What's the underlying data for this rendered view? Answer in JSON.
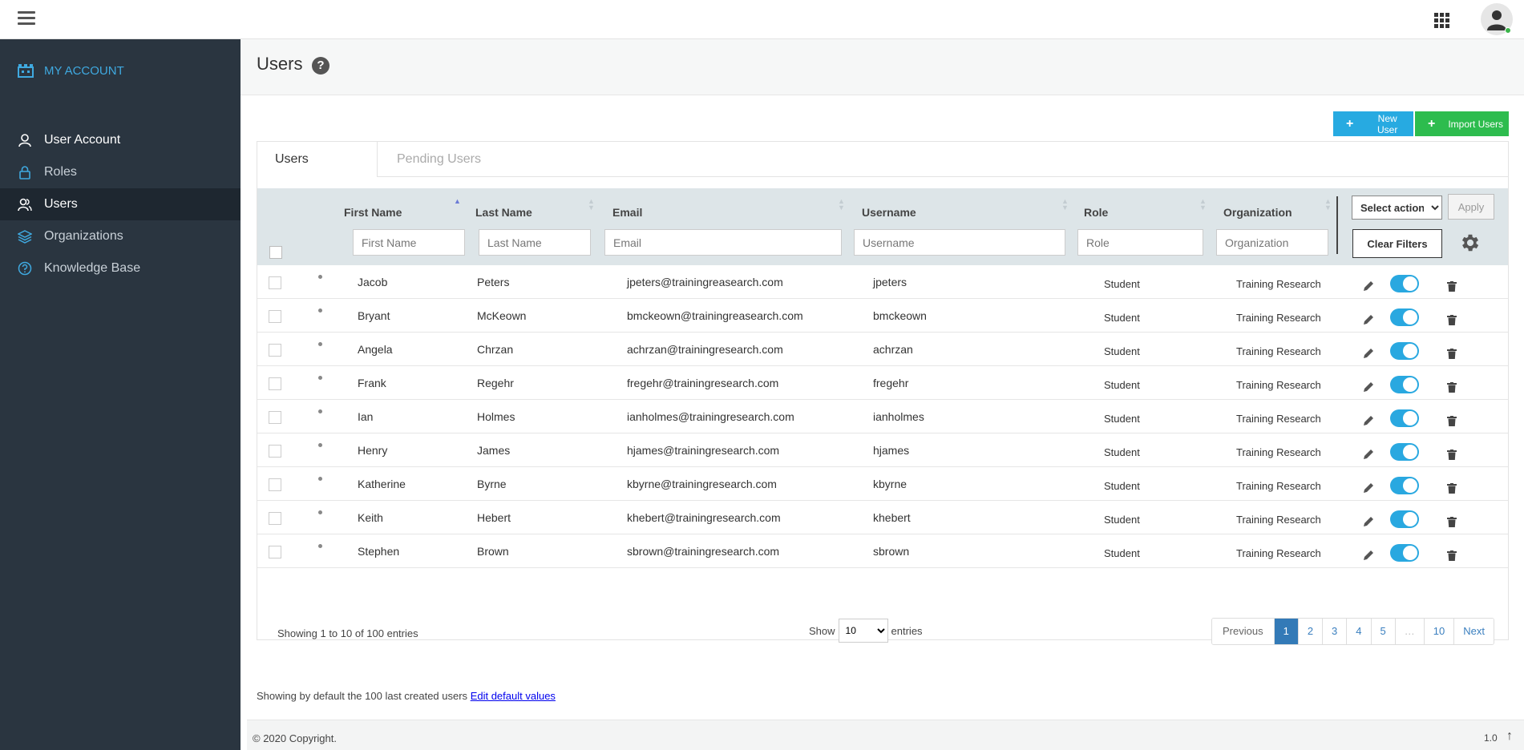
{
  "sidebar": {
    "brand": "MY ACCOUNT",
    "items": [
      {
        "label": "User Account",
        "icon": "user-outline-icon"
      },
      {
        "label": "Roles",
        "icon": "lock-icon"
      },
      {
        "label": "Users",
        "icon": "users-icon"
      },
      {
        "label": "Organizations",
        "icon": "layers-icon"
      },
      {
        "label": "Knowledge Base",
        "icon": "question-circle-icon"
      }
    ]
  },
  "page": {
    "title": "Users",
    "new_user": "New User",
    "import_users": "Import Users"
  },
  "tabs": [
    "Users",
    "Pending Users"
  ],
  "table": {
    "columns": [
      "First Name",
      "Last Name",
      "Email",
      "Username",
      "Role",
      "Organization"
    ],
    "filters": [
      "First Name",
      "Last Name",
      "Email",
      "Username",
      "Role",
      "Organization"
    ],
    "select_action": "Select action",
    "apply": "Apply",
    "clear_filters": "Clear Filters",
    "rows": [
      [
        "Jacob",
        "Peters",
        "jpeters@trainingreasearch.com",
        "jpeters",
        "Student",
        "Training Research"
      ],
      [
        "Bryant",
        "McKeown",
        "bmckeown@trainingreasearch.com",
        "bmckeown",
        "Student",
        "Training Research"
      ],
      [
        "Angela",
        "Chrzan",
        "achrzan@trainingresearch.com",
        "achrzan",
        "Student",
        "Training Research"
      ],
      [
        "Frank",
        "Regehr",
        "fregehr@trainingresearch.com",
        "fregehr",
        "Student",
        "Training Research"
      ],
      [
        "Ian",
        "Holmes",
        "ianholmes@trainingresearch.com",
        "ianholmes",
        "Student",
        "Training Research"
      ],
      [
        "Henry",
        "James",
        "hjames@trainingresearch.com",
        "hjames",
        "Student",
        "Training Research"
      ],
      [
        "Katherine",
        "Byrne",
        "kbyrne@trainingresearch.com",
        "kbyrne",
        "Student",
        "Training Research"
      ],
      [
        "Keith",
        "Hebert",
        "khebert@trainingresearch.com",
        "khebert",
        "Student",
        "Training Research"
      ],
      [
        "Stephen",
        "Brown",
        "sbrown@trainingresearch.com",
        "sbrown",
        "Student",
        "Training Research"
      ]
    ]
  },
  "footer_table": {
    "showing": "Showing 1 to 10 of 100 entries",
    "show": "Show",
    "page_size": "10",
    "entries": "entries",
    "pages": [
      "Previous",
      "1",
      "2",
      "3",
      "4",
      "5",
      "…",
      "10",
      "Next"
    ]
  },
  "note": {
    "text": "Showing by default the 100 last created users",
    "link": "Edit default values"
  },
  "footer": {
    "copyright": "© 2020 Copyright.",
    "version": "1.0",
    "arrow": "↑"
  },
  "colors": {
    "sidebar_bg": "#2a3540",
    "accent": "#27aae1",
    "import_green": "#2dbc4e",
    "toggle_on": "#29a8e0",
    "pager_active": "#337ab7"
  }
}
